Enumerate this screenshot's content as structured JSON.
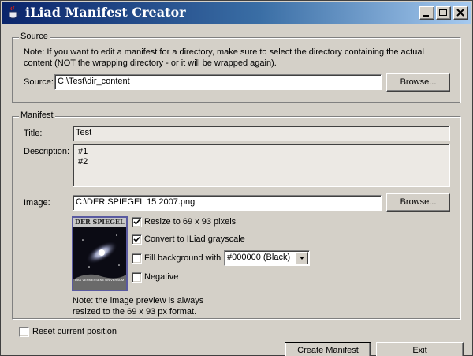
{
  "window": {
    "title": "iLiad Manifest Creator",
    "icon": "java-cup-icon"
  },
  "source": {
    "legend": "Source",
    "note": "Note: If you want to edit a manifest for a directory, make sure to select the directory containing the actual content (NOT the wrapping directory - or it will be wrapped again).",
    "label": "Source:",
    "value": "C:\\Test\\dir_content",
    "browse_label": "Browse..."
  },
  "manifest": {
    "legend": "Manifest",
    "title_label": "Title:",
    "title_value": "Test",
    "description_label": "Description:",
    "description_lines": [
      "#1",
      "#2"
    ],
    "image_label": "Image:",
    "image_value": "C:\\DER SPIEGEL 15 2007.png",
    "browse_label": "Browse...",
    "preview": {
      "masthead": "DER SPIEGEL",
      "cover_line": "DAS VERMESSENE UNIVERSUM"
    },
    "options": {
      "resize": {
        "label": "Resize to 69 x 93 pixels",
        "checked": true
      },
      "grayscale": {
        "label": "Convert to ILiad grayscale",
        "checked": true
      },
      "fill": {
        "label": "Fill background with",
        "checked": false
      },
      "fill_color": {
        "selected": "#000000 (Black)"
      },
      "negative": {
        "label": "Negative",
        "checked": false
      }
    },
    "preview_note_line1": "Note: the image preview is always",
    "preview_note_line2": "resized to the 69 x 93 px format."
  },
  "reset": {
    "label": "Reset current position",
    "checked": false
  },
  "footer": {
    "create_label": "Create Manifest",
    "exit_label": "Exit"
  }
}
